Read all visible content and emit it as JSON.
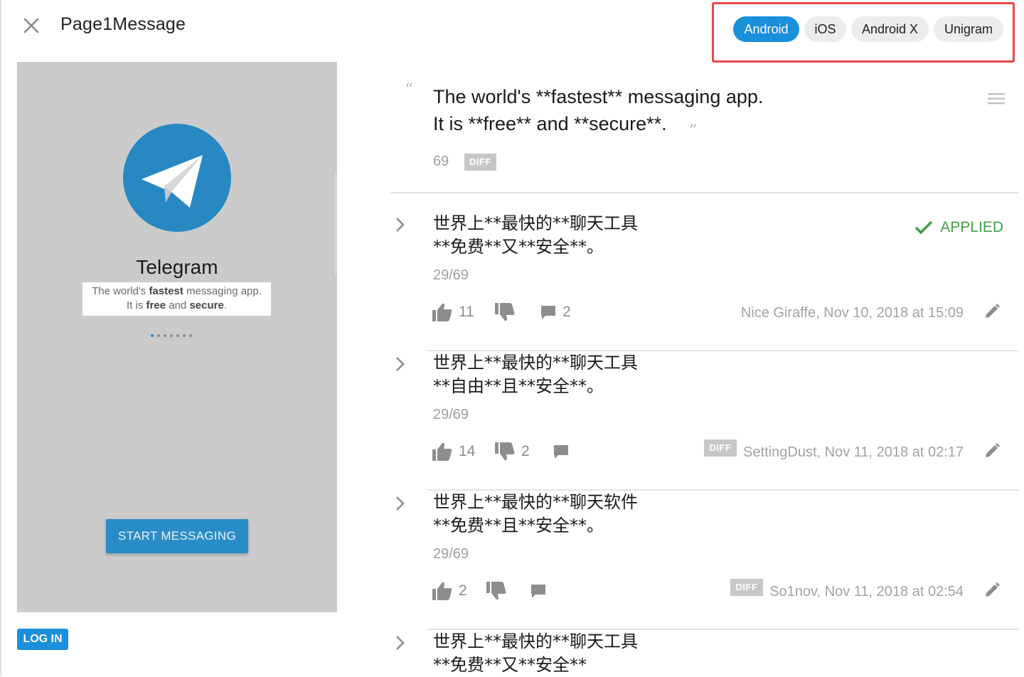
{
  "header": {
    "key_title": "Page1Message",
    "platforms": [
      {
        "label": "Android",
        "active": true
      },
      {
        "label": "iOS",
        "active": false
      },
      {
        "label": "Android X",
        "active": false
      },
      {
        "label": "Unigram",
        "active": false
      }
    ]
  },
  "preview": {
    "app_name": "Telegram",
    "tagline_line1_a": "The world's ",
    "tagline_line1_b": "fastest",
    "tagline_line1_c": " messaging app.",
    "tagline_line2_a": "It is ",
    "tagline_line2_b": "free",
    "tagline_line2_c": " and ",
    "tagline_line2_d": "secure",
    "tagline_line2_e": ".",
    "start_button": "START MESSAGING",
    "page_dots": 7,
    "active_dot": 0
  },
  "login_button": "LOG IN",
  "source": {
    "line1": "The world's **fastest** messaging app.",
    "line2": "It is **free** and **secure**.",
    "open_quote": "“",
    "close_quote": "”",
    "char_count": "69",
    "diff_label": "DIFF"
  },
  "suggestions": [
    {
      "line1": "世界上**最快的**聊天工具",
      "line2": "**免费**又**安全**。",
      "count": "29/69",
      "applied": "APPLIED",
      "upvotes": "11",
      "downvotes": "",
      "comments": "2",
      "diff": "",
      "author": "Nice Giraffe, Nov 10, 2018 at 15:09"
    },
    {
      "line1": "世界上**最快的**聊天工具",
      "line2": "**自由**且**安全**。",
      "count": "29/69",
      "applied": "",
      "upvotes": "14",
      "downvotes": "2",
      "comments": "",
      "diff": "DIFF",
      "author": "SettingDust, Nov 11, 2018 at 02:17"
    },
    {
      "line1": "世界上**最快的**聊天软件",
      "line2": "**免费**且**安全**。",
      "count": "29/69",
      "applied": "",
      "upvotes": "2",
      "downvotes": "",
      "comments": "",
      "diff": "DIFF",
      "author": "So1nov, Nov 11, 2018 at 02:54"
    },
    {
      "line1": "世界上**最快的**聊天工具",
      "line2": "**免费**又**安全**",
      "count": "",
      "applied": "",
      "upvotes": "",
      "downvotes": "",
      "comments": "",
      "diff": "",
      "author": ""
    }
  ],
  "colors": {
    "accent": "#1a8fdb",
    "applied": "#43a047",
    "highlight_border": "#e8484a",
    "preview_bg": "#cbcbcb"
  }
}
